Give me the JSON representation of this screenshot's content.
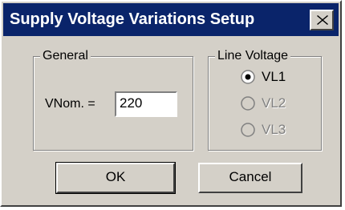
{
  "window": {
    "title": "Supply Voltage Variations Setup",
    "close_icon": "close-icon"
  },
  "general": {
    "group_label": "General",
    "vnom_label": "VNom. =",
    "vnom_value": "220"
  },
  "line_voltage": {
    "group_label": "Line Voltage",
    "options": [
      {
        "label": "VL1",
        "selected": true,
        "enabled": true
      },
      {
        "label": "VL2",
        "selected": false,
        "enabled": false
      },
      {
        "label": "VL3",
        "selected": false,
        "enabled": false
      }
    ]
  },
  "buttons": {
    "ok_label": "OK",
    "cancel_label": "Cancel"
  },
  "colors": {
    "title_bar": "#0a246a",
    "face": "#d4d0c8"
  }
}
